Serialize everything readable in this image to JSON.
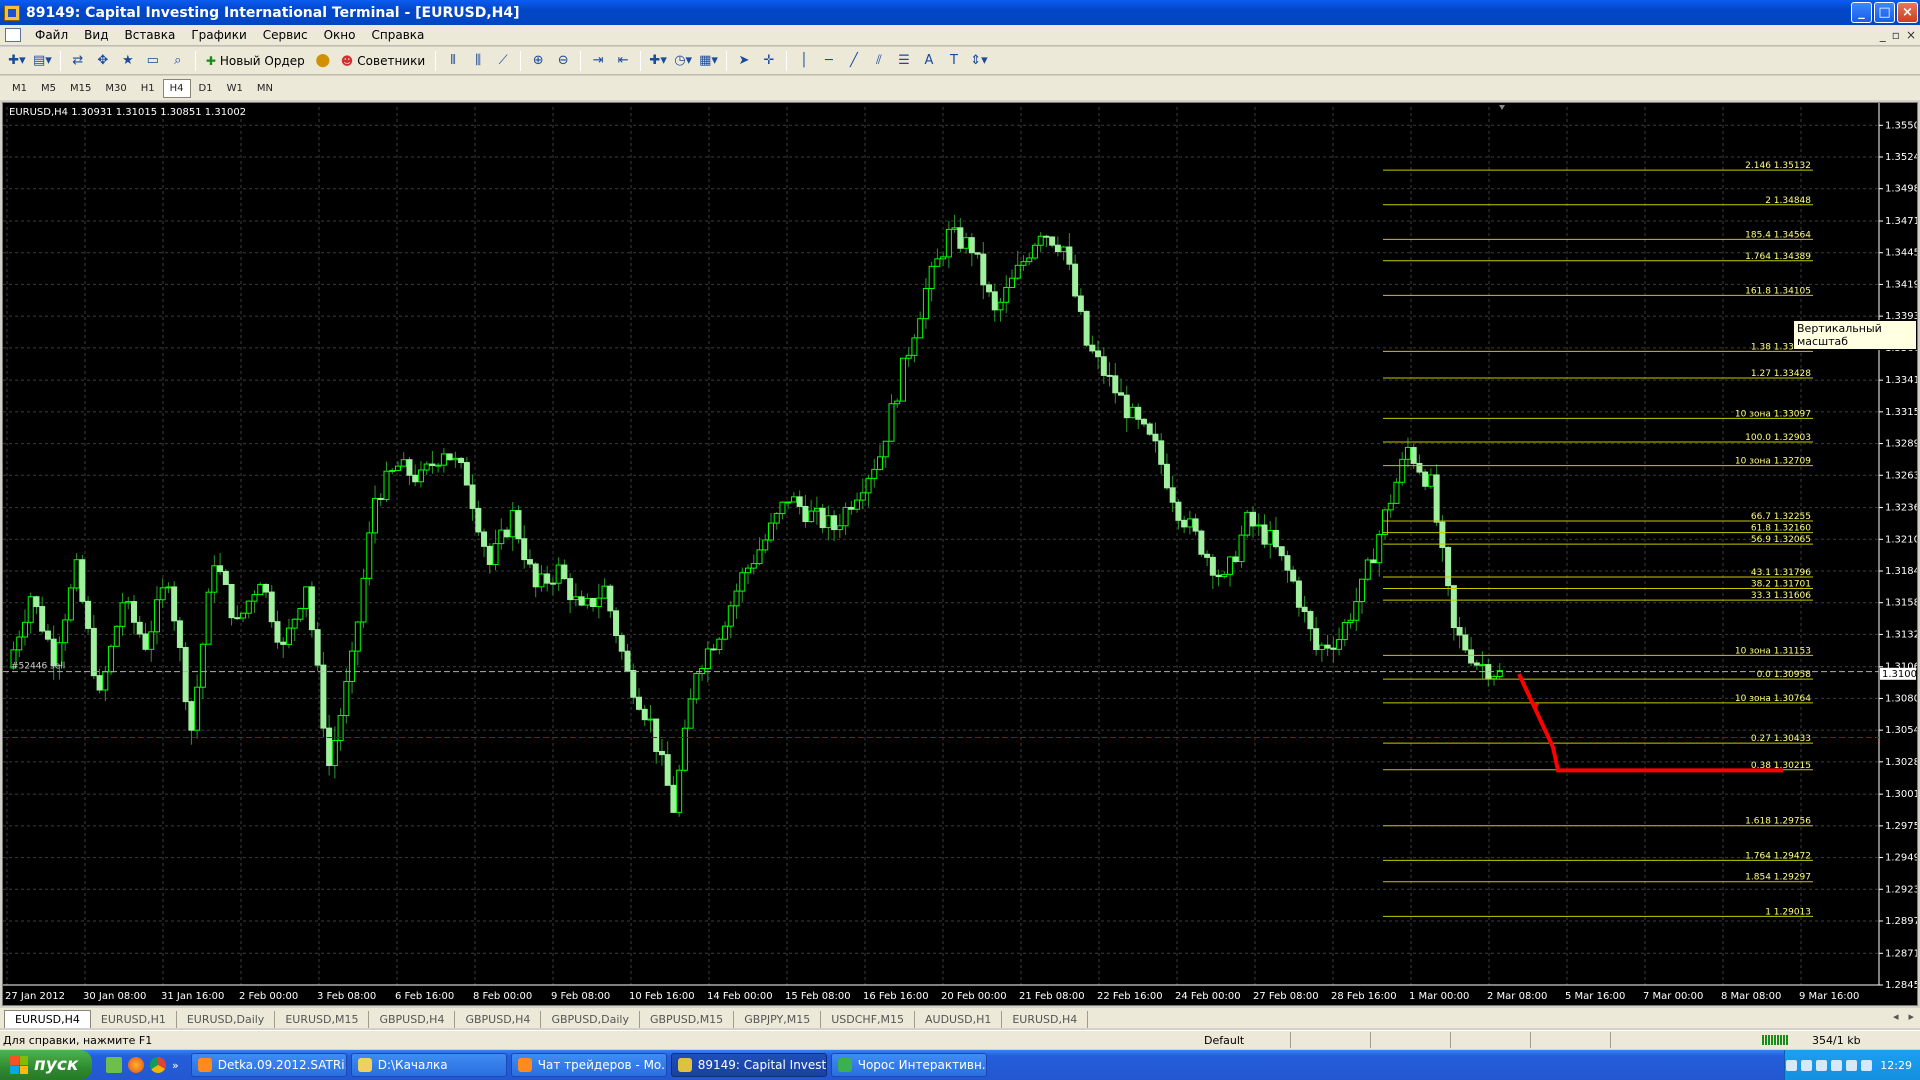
{
  "window": {
    "title": "89149: Capital Investing International Terminal - [EURUSD,H4]",
    "minimize_icon": "minimize-icon",
    "maximize_icon": "maximize-icon",
    "close_icon": "close-icon"
  },
  "menu": {
    "items": [
      "Файл",
      "Вид",
      "Вставка",
      "Графики",
      "Сервис",
      "Окно",
      "Справка"
    ],
    "mdi_controls": [
      "_",
      "▫",
      "×"
    ]
  },
  "toolbar": {
    "new_order_label": "Новый Ордер",
    "experts_label": "Советники"
  },
  "timeframes": [
    "M1",
    "M5",
    "M15",
    "M30",
    "H1",
    "H4",
    "D1",
    "W1",
    "MN"
  ],
  "active_timeframe": "H4",
  "chart": {
    "info": "EURUSD,H4  1.30931 1.31015 1.30851 1.31002",
    "order_label": "#52446 sell",
    "vertical_scale_tooltip": "Вертикальный масштаб",
    "current_price_label": "1.31002",
    "colors": {
      "background": "#000000",
      "grid": "#3c3c3c",
      "bull_candle": "#00ff00",
      "bear_candle": "#a0f0a0",
      "wick": "#2a9a2a",
      "fibo_line": "#c8c800",
      "fibo_text": "#ffff80",
      "arrow": "#ff0000",
      "order_line": "#b0b0b0",
      "stop_line": "#b00000"
    },
    "price_axis": [
      "1.35500",
      "1.35240",
      "1.34980",
      "1.34715",
      "1.34455",
      "1.34195",
      "1.33935",
      "1.33675",
      "1.33410",
      "1.33150",
      "1.32890",
      "1.32630",
      "1.32365",
      "1.32105",
      "1.31845",
      "1.31585",
      "1.31325",
      "1.31060",
      "1.30800",
      "1.30540",
      "1.30280",
      "1.30015",
      "1.29755",
      "1.29495",
      "1.29235",
      "1.28975",
      "1.28710",
      "1.28450"
    ],
    "time_axis": [
      "27 Jan 2012",
      "30 Jan 08:00",
      "31 Jan 16:00",
      "2 Feb 00:00",
      "3 Feb 08:00",
      "6 Feb 16:00",
      "8 Feb 00:00",
      "9 Feb 08:00",
      "10 Feb 16:00",
      "14 Feb 00:00",
      "15 Feb 08:00",
      "16 Feb 16:00",
      "20 Feb 00:00",
      "21 Feb 08:00",
      "22 Feb 16:00",
      "24 Feb 00:00",
      "27 Feb 08:00",
      "28 Feb 16:00",
      "1 Mar 00:00",
      "2 Mar 08:00",
      "5 Mar 16:00",
      "7 Mar 00:00",
      "8 Mar 08:00",
      "9 Mar 16:00"
    ],
    "fibo_levels": [
      {
        "label": "2.146 1.35132",
        "price": 1.35132
      },
      {
        "label": "2 1.34848",
        "price": 1.34848
      },
      {
        "label": "185.4 1.34564",
        "price": 1.34564
      },
      {
        "label": "1.764 1.34389",
        "price": 1.34389
      },
      {
        "label": "161.8 1.34105",
        "price": 1.34105
      },
      {
        "label": "1.38 1.33646",
        "price": 1.33646
      },
      {
        "label": "1.27 1.33428",
        "price": 1.33428
      },
      {
        "label": "10 зона 1.33097",
        "price": 1.33097
      },
      {
        "label": "100.0 1.32903",
        "price": 1.32903
      },
      {
        "label": "10 зона 1.32709",
        "price": 1.32709
      },
      {
        "label": "66.7 1.32255",
        "price": 1.32255
      },
      {
        "label": "61.8 1.32160",
        "price": 1.3216
      },
      {
        "label": "56.9 1.32065",
        "price": 1.32065
      },
      {
        "label": "43.1 1.31796",
        "price": 1.31796
      },
      {
        "label": "38.2 1.31701",
        "price": 1.31701
      },
      {
        "label": "33.3 1.31606",
        "price": 1.31606
      },
      {
        "label": "10 зона 1.31153",
        "price": 1.31153
      },
      {
        "label": "0.0 1.30958",
        "price": 1.30958
      },
      {
        "label": "10 зона 1.30764",
        "price": 1.30764
      },
      {
        "label": "0.27 1.30433",
        "price": 1.30433
      },
      {
        "label": "0.38 1.30215",
        "price": 1.30215
      },
      {
        "label": "1.618 1.29756",
        "price": 1.29756
      },
      {
        "label": "1.764 1.29472",
        "price": 1.29472
      },
      {
        "label": "1.854 1.29297",
        "price": 1.29297
      },
      {
        "label": "1 1.29013",
        "price": 1.29013
      }
    ]
  },
  "chart_data": {
    "type": "candlestick",
    "symbol": "EURUSD",
    "timeframe": "H4",
    "ylim": [
      1.2845,
      1.3565
    ],
    "x": [
      "27 Jan 2012",
      "30 Jan 08:00",
      "31 Jan 16:00",
      "2 Feb 00:00",
      "3 Feb 08:00",
      "6 Feb 16:00",
      "8 Feb 00:00",
      "9 Feb 08:00",
      "10 Feb 16:00",
      "14 Feb 00:00",
      "15 Feb 08:00",
      "16 Feb 16:00",
      "20 Feb 00:00",
      "21 Feb 08:00",
      "22 Feb 16:00",
      "24 Feb 00:00",
      "27 Feb 08:00",
      "28 Feb 16:00",
      "1 Mar 00:00",
      "2 Mar 08:00",
      "5 Mar 16:00",
      "7 Mar 00:00",
      "8 Mar 08:00",
      "9 Mar 16:00"
    ],
    "close_path": [
      1.3105,
      1.3165,
      1.3115,
      1.3185,
      1.308,
      1.316,
      1.3125,
      1.318,
      1.3055,
      1.3195,
      1.314,
      1.318,
      1.312,
      1.3175,
      1.3025,
      1.311,
      1.3245,
      1.327,
      1.326,
      1.3285,
      1.326,
      1.319,
      1.323,
      1.317,
      1.3185,
      1.315,
      1.317,
      1.31,
      1.306,
      1.299,
      1.3105,
      1.3135,
      1.318,
      1.321,
      1.3245,
      1.323,
      1.322,
      1.325,
      1.328,
      1.335,
      1.3415,
      1.346,
      1.345,
      1.3395,
      1.343,
      1.3465,
      1.345,
      1.337,
      1.334,
      1.331,
      1.3285,
      1.3235,
      1.3205,
      1.3175,
      1.3225,
      1.321,
      1.3175,
      1.312,
      1.313,
      1.317,
      1.323,
      1.3285,
      1.3255,
      1.3135,
      1.311,
      1.31
    ],
    "annotations": {
      "projected_move": [
        1.31,
        1.304,
        1.3021,
        1.3021
      ]
    }
  },
  "symbol_tabs": [
    "EURUSD,H4",
    "EURUSD,H1",
    "EURUSD,Daily",
    "EURUSD,M15",
    "GBPUSD,H4",
    "GBPUSD,H4",
    "GBPUSD,Daily",
    "GBPUSD,M15",
    "GBPJPY,M15",
    "USDCHF,M15",
    "AUDUSD,H1",
    "EURUSD,H4"
  ],
  "status": {
    "help": "Для справки, нажмите F1",
    "profile": "Default",
    "traffic": "354/1 kb"
  },
  "taskbar": {
    "start": "пуск",
    "tasks": [
      {
        "label": "Detka.09.2012.SATRi...",
        "icon": "firefox-icon"
      },
      {
        "label": "D:\\Качалка",
        "icon": "folder-icon"
      },
      {
        "label": "Чат трейдеров - Mo...",
        "icon": "firefox-icon"
      },
      {
        "label": "89149: Capital Invest...",
        "icon": "terminal-icon"
      },
      {
        "label": "Чорос Интерактивн...",
        "icon": "chrome-icon"
      }
    ],
    "clock": "12:29"
  }
}
